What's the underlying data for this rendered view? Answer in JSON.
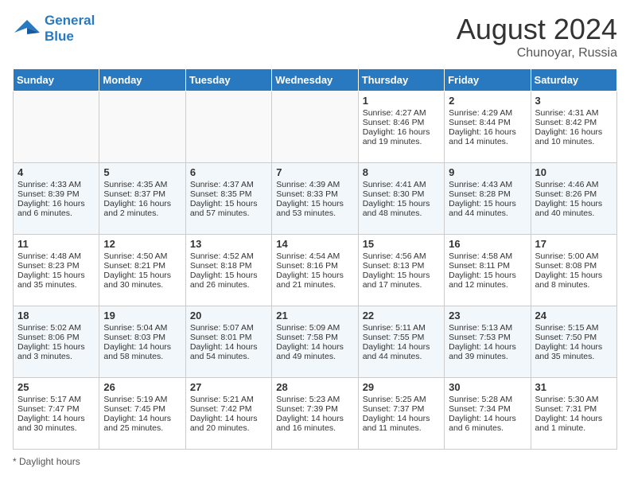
{
  "header": {
    "logo_line1": "General",
    "logo_line2": "Blue",
    "month_year": "August 2024",
    "location": "Chunoyar, Russia"
  },
  "footer": {
    "label": "Daylight hours"
  },
  "days_of_week": [
    "Sunday",
    "Monday",
    "Tuesday",
    "Wednesday",
    "Thursday",
    "Friday",
    "Saturday"
  ],
  "weeks": [
    [
      {
        "day": "",
        "info": ""
      },
      {
        "day": "",
        "info": ""
      },
      {
        "day": "",
        "info": ""
      },
      {
        "day": "",
        "info": ""
      },
      {
        "day": "1",
        "info": "Sunrise: 4:27 AM\nSunset: 8:46 PM\nDaylight: 16 hours\nand 19 minutes."
      },
      {
        "day": "2",
        "info": "Sunrise: 4:29 AM\nSunset: 8:44 PM\nDaylight: 16 hours\nand 14 minutes."
      },
      {
        "day": "3",
        "info": "Sunrise: 4:31 AM\nSunset: 8:42 PM\nDaylight: 16 hours\nand 10 minutes."
      }
    ],
    [
      {
        "day": "4",
        "info": "Sunrise: 4:33 AM\nSunset: 8:39 PM\nDaylight: 16 hours\nand 6 minutes."
      },
      {
        "day": "5",
        "info": "Sunrise: 4:35 AM\nSunset: 8:37 PM\nDaylight: 16 hours\nand 2 minutes."
      },
      {
        "day": "6",
        "info": "Sunrise: 4:37 AM\nSunset: 8:35 PM\nDaylight: 15 hours\nand 57 minutes."
      },
      {
        "day": "7",
        "info": "Sunrise: 4:39 AM\nSunset: 8:33 PM\nDaylight: 15 hours\nand 53 minutes."
      },
      {
        "day": "8",
        "info": "Sunrise: 4:41 AM\nSunset: 8:30 PM\nDaylight: 15 hours\nand 48 minutes."
      },
      {
        "day": "9",
        "info": "Sunrise: 4:43 AM\nSunset: 8:28 PM\nDaylight: 15 hours\nand 44 minutes."
      },
      {
        "day": "10",
        "info": "Sunrise: 4:46 AM\nSunset: 8:26 PM\nDaylight: 15 hours\nand 40 minutes."
      }
    ],
    [
      {
        "day": "11",
        "info": "Sunrise: 4:48 AM\nSunset: 8:23 PM\nDaylight: 15 hours\nand 35 minutes."
      },
      {
        "day": "12",
        "info": "Sunrise: 4:50 AM\nSunset: 8:21 PM\nDaylight: 15 hours\nand 30 minutes."
      },
      {
        "day": "13",
        "info": "Sunrise: 4:52 AM\nSunset: 8:18 PM\nDaylight: 15 hours\nand 26 minutes."
      },
      {
        "day": "14",
        "info": "Sunrise: 4:54 AM\nSunset: 8:16 PM\nDaylight: 15 hours\nand 21 minutes."
      },
      {
        "day": "15",
        "info": "Sunrise: 4:56 AM\nSunset: 8:13 PM\nDaylight: 15 hours\nand 17 minutes."
      },
      {
        "day": "16",
        "info": "Sunrise: 4:58 AM\nSunset: 8:11 PM\nDaylight: 15 hours\nand 12 minutes."
      },
      {
        "day": "17",
        "info": "Sunrise: 5:00 AM\nSunset: 8:08 PM\nDaylight: 15 hours\nand 8 minutes."
      }
    ],
    [
      {
        "day": "18",
        "info": "Sunrise: 5:02 AM\nSunset: 8:06 PM\nDaylight: 15 hours\nand 3 minutes."
      },
      {
        "day": "19",
        "info": "Sunrise: 5:04 AM\nSunset: 8:03 PM\nDaylight: 14 hours\nand 58 minutes."
      },
      {
        "day": "20",
        "info": "Sunrise: 5:07 AM\nSunset: 8:01 PM\nDaylight: 14 hours\nand 54 minutes."
      },
      {
        "day": "21",
        "info": "Sunrise: 5:09 AM\nSunset: 7:58 PM\nDaylight: 14 hours\nand 49 minutes."
      },
      {
        "day": "22",
        "info": "Sunrise: 5:11 AM\nSunset: 7:55 PM\nDaylight: 14 hours\nand 44 minutes."
      },
      {
        "day": "23",
        "info": "Sunrise: 5:13 AM\nSunset: 7:53 PM\nDaylight: 14 hours\nand 39 minutes."
      },
      {
        "day": "24",
        "info": "Sunrise: 5:15 AM\nSunset: 7:50 PM\nDaylight: 14 hours\nand 35 minutes."
      }
    ],
    [
      {
        "day": "25",
        "info": "Sunrise: 5:17 AM\nSunset: 7:47 PM\nDaylight: 14 hours\nand 30 minutes."
      },
      {
        "day": "26",
        "info": "Sunrise: 5:19 AM\nSunset: 7:45 PM\nDaylight: 14 hours\nand 25 minutes."
      },
      {
        "day": "27",
        "info": "Sunrise: 5:21 AM\nSunset: 7:42 PM\nDaylight: 14 hours\nand 20 minutes."
      },
      {
        "day": "28",
        "info": "Sunrise: 5:23 AM\nSunset: 7:39 PM\nDaylight: 14 hours\nand 16 minutes."
      },
      {
        "day": "29",
        "info": "Sunrise: 5:25 AM\nSunset: 7:37 PM\nDaylight: 14 hours\nand 11 minutes."
      },
      {
        "day": "30",
        "info": "Sunrise: 5:28 AM\nSunset: 7:34 PM\nDaylight: 14 hours\nand 6 minutes."
      },
      {
        "day": "31",
        "info": "Sunrise: 5:30 AM\nSunset: 7:31 PM\nDaylight: 14 hours\nand 1 minute."
      }
    ]
  ]
}
